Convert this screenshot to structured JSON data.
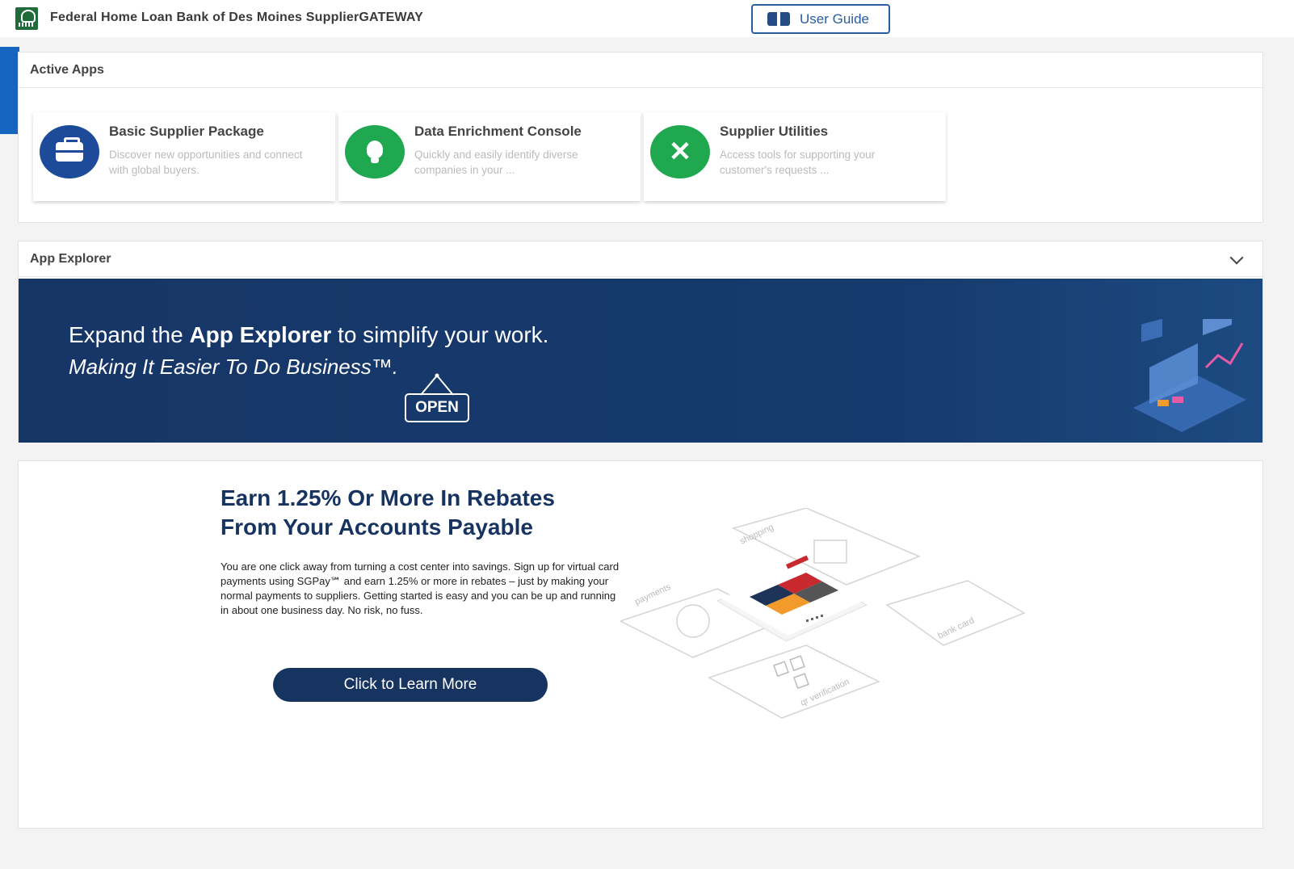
{
  "header": {
    "title": "Federal Home Loan Bank of Des Moines SupplierGATEWAY",
    "user_guide_label": "User Guide"
  },
  "active_apps": {
    "title": "Active Apps",
    "cards": [
      {
        "title": "Basic Supplier Package",
        "description": "Discover new opportunities and connect with global buyers.",
        "icon": "briefcase-icon",
        "color": "#1d4b9a"
      },
      {
        "title": "Data Enrichment Console",
        "description": "Quickly and easily identify diverse companies in your ...",
        "icon": "lightbulb-icon",
        "color": "#1fa84f"
      },
      {
        "title": "Supplier Utilities",
        "description": "Access tools for supporting your customer's requests ...",
        "icon": "tools-icon",
        "color": "#1fa84f"
      }
    ]
  },
  "app_explorer": {
    "title": "App Explorer",
    "banner_pre": "Expand the ",
    "banner_bold": "App Explorer",
    "banner_post": " to simplify your work.",
    "tagline": "Making It Easier To Do Business™.",
    "open_sign": "OPEN"
  },
  "promo": {
    "headline_line1": "Earn 1.25% Or More In Rebates",
    "headline_line2": "From Your Accounts Payable",
    "body": "You are one click away from turning a cost center into savings. Sign up for virtual card payments using SGPay℠ and earn 1.25% or more in rebates – just by making your normal payments to suppliers.  Getting started is easy and you can be up and running in about one business day.  No risk, no fuss.",
    "cta_label": "Click to Learn More",
    "art_labels": [
      "shopping",
      "payments",
      "bank card",
      "qr verification"
    ]
  },
  "colors": {
    "accent": "#1565c0",
    "navy": "#17335f",
    "green": "#1fa84f"
  }
}
